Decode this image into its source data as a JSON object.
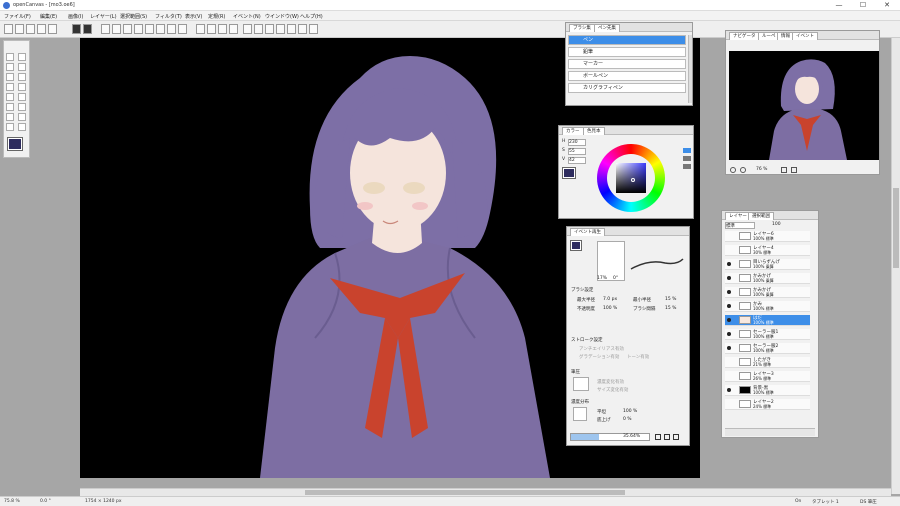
{
  "window": {
    "title": "openCanvas - [mo3.oe6]",
    "minimize": "—",
    "maximize": "☐",
    "close": "✕"
  },
  "menu": [
    "ファイル(F)",
    "編集(E)",
    "画像(I)",
    "レイヤー(L)",
    "選択範囲(S)",
    "フィルタ(T)",
    "表示(V)",
    "定規(R)",
    "イベント(N)",
    "ウインドウ(W)",
    "ヘルプ(H)"
  ],
  "brush_panel": {
    "tabs": [
      "ブラシ集",
      "ペン先集"
    ],
    "items": [
      "ペン",
      "鉛筆",
      "マーカー",
      "ボールペン",
      "カリグラフィペン"
    ],
    "selected": 0
  },
  "color_panel": {
    "tabs": [
      "カラー",
      "色見本"
    ],
    "h_label": "H",
    "h": "230",
    "s_label": "S",
    "s": "55",
    "v_label": "V",
    "v": "42",
    "main_color": "#2e2c5e"
  },
  "navigator": {
    "tabs": [
      "ナビゲータ",
      "ルーペ",
      "情報",
      "イベント"
    ],
    "zoom": "76 %"
  },
  "event_panel": {
    "tab": "イベント再生",
    "brush_pct": "17%",
    "brush_pct2": "0°",
    "brush_settings_title": "ブラシ設定",
    "max_radius_label": "最大半径",
    "max_radius": "7.0 px",
    "min_radius_label": "最小半径",
    "min_radius": "15 %",
    "opacity_label": "不透明度",
    "opacity": "100 %",
    "spacing_label": "ブラシ間隔",
    "spacing": "15 %",
    "stroke_title": "ストローク設定",
    "stroke_opts": [
      "アンチエイリアス有効",
      "グラデーション有効",
      "トーン有効"
    ],
    "pressure_title": "筆圧",
    "pressure_opts": [
      "濃度変化有効",
      "サイズ変化有効"
    ],
    "density_title": "濃度分布",
    "smooth_label": "平坦",
    "smooth": "100 %",
    "raise_label": "底上げ",
    "raise": "0 %",
    "progress_text": "35.64%",
    "progress_value": 0.3564
  },
  "layers_panel": {
    "tabs": [
      "レイヤー",
      "選択範囲"
    ],
    "mode": "標準",
    "opacity": "100",
    "layers": [
      {
        "name": "レイヤー6",
        "sub": "100% 標準",
        "thumb": "#ffffff",
        "visible": false
      },
      {
        "name": "レイヤー4",
        "sub": "30% 標準",
        "thumb": "#ffffff",
        "visible": false
      },
      {
        "name": "目いらずんげ",
        "sub": "100% 乗算",
        "thumb": "#ffffff",
        "visible": true
      },
      {
        "name": "かみかげ",
        "sub": "100% 乗算",
        "thumb": "#ffffff",
        "visible": true
      },
      {
        "name": "かみかげ",
        "sub": "100% 乗算",
        "thumb": "#ffffff",
        "visible": true
      },
      {
        "name": "かみ",
        "sub": "100% 標準",
        "thumb": "#ffffff",
        "visible": true
      },
      {
        "name": "はだ",
        "sub": "100% 標準",
        "thumb": "#f7e8df",
        "visible": true,
        "selected": true
      },
      {
        "name": "セーラー服1",
        "sub": "100% 標準",
        "thumb": "#ffffff",
        "visible": true
      },
      {
        "name": "セーラー服2",
        "sub": "100% 標準",
        "thumb": "#ffffff",
        "visible": true
      },
      {
        "name": "したがき",
        "sub": "21% 標準",
        "thumb": "#ffffff",
        "visible": false
      },
      {
        "name": "レイヤー3",
        "sub": "26% 標準",
        "thumb": "#ffffff",
        "visible": false
      },
      {
        "name": "背景-黒",
        "sub": "100% 標準",
        "thumb": "#000000",
        "visible": true
      },
      {
        "name": "レイヤー2",
        "sub": "24% 標準",
        "thumb": "#ffffff",
        "visible": false
      }
    ]
  },
  "status": {
    "zoom": "75.8 %",
    "angle": "0.0 °",
    "size": "1754 × 1240 px",
    "on": "On",
    "tablet": "タブレット 1",
    "ds": "DS 筆圧"
  },
  "colors": {
    "hair": "#7d6fa6",
    "uniform": "#7d6ea3",
    "tie": "#c9432d",
    "skin": "#f5e4dc"
  }
}
